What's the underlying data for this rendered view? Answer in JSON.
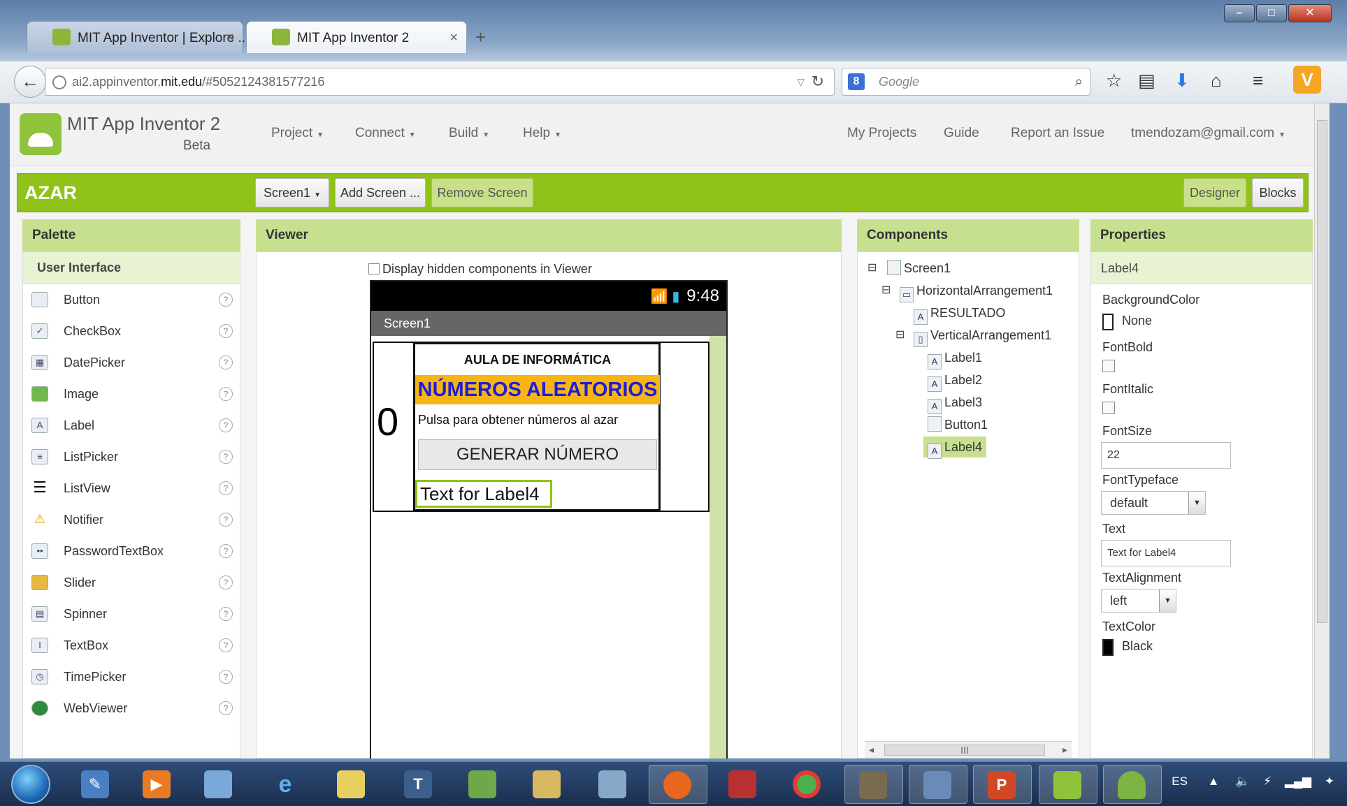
{
  "browser": {
    "tabs": [
      {
        "label": "MIT App Inventor | Explore ..."
      },
      {
        "label": "MIT App Inventor 2"
      }
    ],
    "new_tab_symbol": "+",
    "url": {
      "prefix": "ai2.appinventor.",
      "host": "mit.edu",
      "path": "/#5052124381577216"
    },
    "search_placeholder": "Google",
    "search_engine_letter": "8",
    "extension_letter": "V"
  },
  "app": {
    "title": "MIT App Inventor 2",
    "beta": "Beta",
    "menus": [
      "Project",
      "Connect",
      "Build",
      "Help"
    ],
    "links": [
      "My Projects",
      "Guide",
      "Report an Issue",
      "tmendozam@gmail.com"
    ],
    "project_name": "AZAR",
    "screen_button": "Screen1",
    "add_screen": "Add Screen ...",
    "remove_screen": "Remove Screen",
    "designer": "Designer",
    "blocks": "Blocks"
  },
  "palette": {
    "title": "Palette",
    "section": "User Interface",
    "items": [
      {
        "label": "Button",
        "icon": "button-icon"
      },
      {
        "label": "CheckBox",
        "icon": "checkbox-icon"
      },
      {
        "label": "DatePicker",
        "icon": "datepicker-icon"
      },
      {
        "label": "Image",
        "icon": "image-icon"
      },
      {
        "label": "Label",
        "icon": "label-icon"
      },
      {
        "label": "ListPicker",
        "icon": "listpicker-icon"
      },
      {
        "label": "ListView",
        "icon": "listview-icon"
      },
      {
        "label": "Notifier",
        "icon": "notifier-icon"
      },
      {
        "label": "PasswordTextBox",
        "icon": "password-icon"
      },
      {
        "label": "Slider",
        "icon": "slider-icon"
      },
      {
        "label": "Spinner",
        "icon": "spinner-icon"
      },
      {
        "label": "TextBox",
        "icon": "textbox-icon"
      },
      {
        "label": "TimePicker",
        "icon": "timepicker-icon"
      },
      {
        "label": "WebViewer",
        "icon": "webviewer-icon"
      }
    ],
    "help_symbol": "?"
  },
  "viewer": {
    "title": "Viewer",
    "hidden_checkbox": "Display hidden components in Viewer",
    "status_time": "9:48",
    "screen_title": "Screen1",
    "result_value": "0",
    "label1": "AULA DE INFORMÁTICA",
    "label2": "NÚMEROS ALEATORIOS",
    "label3": "Pulsa para obtener números al azar",
    "button1": "GENERAR NÚMERO",
    "label4": "Text for Label4"
  },
  "components": {
    "title": "Components",
    "tree": [
      "Screen1",
      "HorizontalArrangement1",
      "RESULTADO",
      "VerticalArrangement1",
      "Label1",
      "Label2",
      "Label3",
      "Button1",
      "Label4"
    ],
    "scroll_grip": "III"
  },
  "properties": {
    "title": "Properties",
    "selected": "Label4",
    "background_color_label": "BackgroundColor",
    "background_color_value": "None",
    "fontbold_label": "FontBold",
    "fontitalic_label": "FontItalic",
    "fontsize_label": "FontSize",
    "fontsize_value": "22",
    "fonttypeface_label": "FontTypeface",
    "fonttypeface_value": "default",
    "text_label": "Text",
    "text_value": "Text for Label4",
    "textalignment_label": "TextAlignment",
    "textalignment_value": "left",
    "textcolor_label": "TextColor",
    "textcolor_value": "Black"
  },
  "taskbar": {
    "language": "ES"
  },
  "colors": {
    "accent_green": "#90c21a",
    "panel_header": "#c7e08f",
    "label2_bg": "#f7b515",
    "label2_text": "#1d1ddc"
  }
}
